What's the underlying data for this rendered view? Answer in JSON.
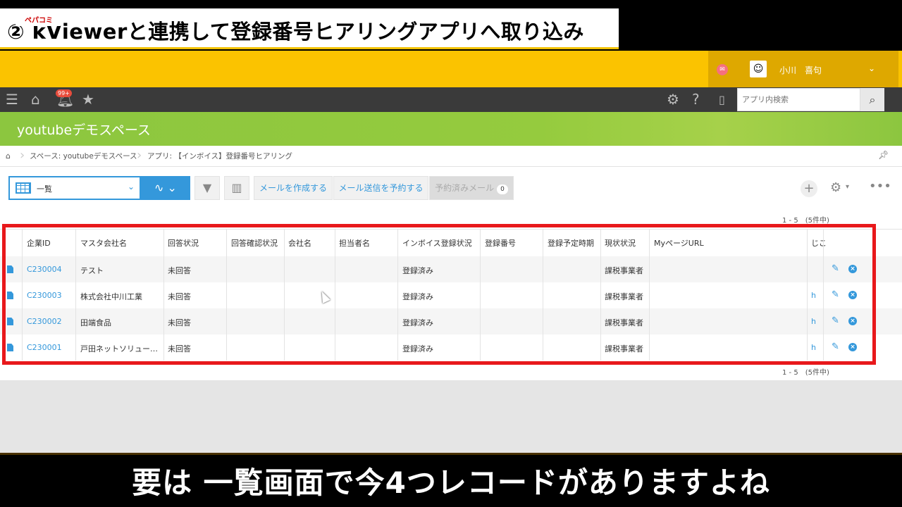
{
  "banner": {
    "title": "② kViewerと連携して登録番号ヒアリングアプリへ取り込み"
  },
  "header": {
    "logo_text": "ペパコミ",
    "user_name": "小川　喜句",
    "avatar_icon": "avatar-icon",
    "accent": "#fbc300"
  },
  "toolbar": {
    "search_placeholder": "アプリ内検索",
    "notification_badge": "99+"
  },
  "space": {
    "title": "youtubeデモスペース",
    "color": "#8cc63f"
  },
  "breadcrumb": {
    "space": "スペース: youtubeデモスペース",
    "app": "アプリ: 【インボイス】登録番号ヒアリング"
  },
  "view": {
    "selected": "一覧",
    "mail_create": "メールを作成する",
    "mail_schedule": "メール送信を予約する",
    "mail_scheduled": "予約済みメール",
    "mail_scheduled_count": "0"
  },
  "pager": {
    "range": "1 - 5",
    "total": "(5件中)"
  },
  "table": {
    "headers": [
      "企業ID",
      "マスタ会社名",
      "回答状況",
      "回答確認状況",
      "会社名",
      "担当者名",
      "インボイス登録状況",
      "登録番号",
      "登録予定時期",
      "現状状況",
      "MyページURL",
      "じこ"
    ],
    "rows": [
      {
        "id": "C230004",
        "master": "テスト",
        "answer": "未回答",
        "invoice": "登録済み",
        "status": "課税事業者",
        "url": ""
      },
      {
        "id": "C230003",
        "master": "株式会社中川工業",
        "answer": "未回答",
        "invoice": "登録済み",
        "status": "課税事業者",
        "url": "h"
      },
      {
        "id": "C230002",
        "master": "田端食品",
        "answer": "未回答",
        "invoice": "登録済み",
        "status": "課税事業者",
        "url": "h"
      },
      {
        "id": "C230001",
        "master": "戸田ネットソリュー…",
        "answer": "未回答",
        "invoice": "登録済み",
        "status": "課税事業者",
        "url": "h"
      }
    ]
  },
  "subtitle": "要は 一覧画面で今4つレコードがありますよね"
}
